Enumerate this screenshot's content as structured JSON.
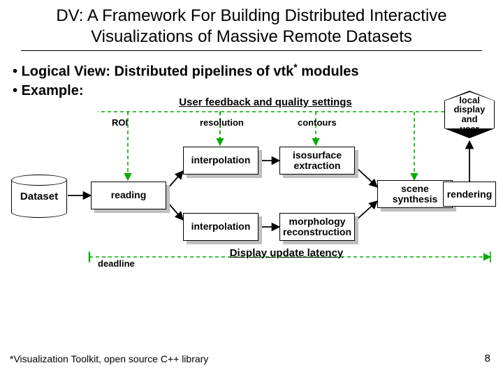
{
  "title": "DV: A Framework For Building Distributed Interactive Visualizations of Massive Remote Datasets",
  "bullets": {
    "b1_prefix": "Logical View: Distributed pipelines of vtk",
    "b1_star": "*",
    "b1_suffix": " modules",
    "b2": "Example:"
  },
  "feedback_caption": "User feedback and quality settings",
  "feedback_labels": {
    "roi": "ROI",
    "resolution": "resolution",
    "contours": "contours"
  },
  "hex_lines": {
    "l1": "local",
    "l2": "display",
    "l3": "and",
    "l4": "user"
  },
  "nodes": {
    "dataset": "Dataset",
    "reading": "reading",
    "interp1": "interpolation",
    "interp2": "interpolation",
    "iso_l1": "isosurface",
    "iso_l2": "extraction",
    "morph_l1": "morphology",
    "morph_l2": "reconstruction",
    "scene_l1": "scene",
    "scene_l2": "synthesis",
    "rendering": "rendering"
  },
  "latency": {
    "caption": "Display update latency",
    "deadline": "deadline"
  },
  "footnote": "*Visualization Toolkit, open source C++ library",
  "page_number": "8"
}
